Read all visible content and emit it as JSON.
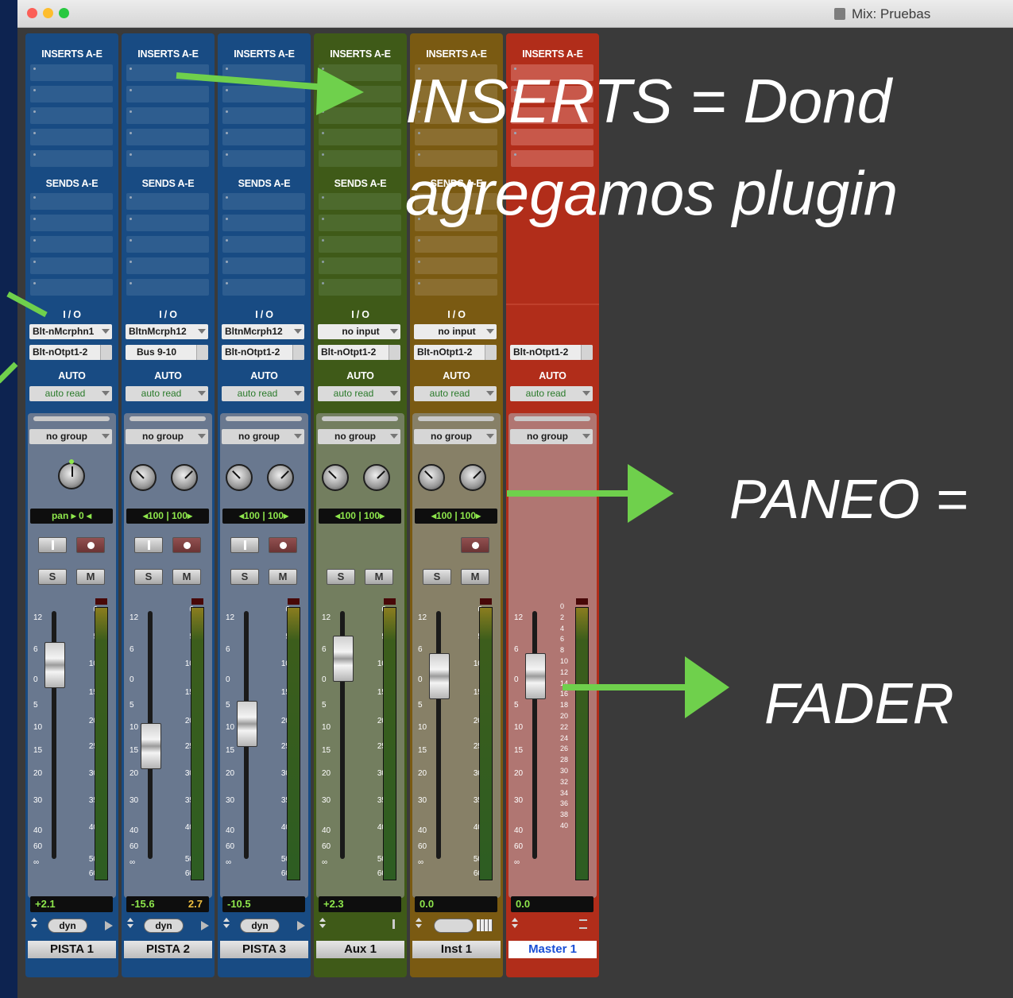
{
  "window": {
    "title": "Mix: Pruebas"
  },
  "tracks": [
    {
      "name": "PISTA 1",
      "color": "#184b83",
      "panel": "#69788f",
      "inserts_label": "INSERTS A-E",
      "sends_label": "SENDS A-E",
      "io_label": "I / O",
      "input": "Blt-nMcrphn1",
      "output": "Blt-nOtpt1-2",
      "auto_label": "AUTO",
      "auto_mode": "auto read",
      "group": "no group",
      "pan_text": "pan   ▸ 0 ◂",
      "volume": "+2.1",
      "peak": "",
      "mode_label": "dyn",
      "selected": false
    },
    {
      "name": "PISTA 2",
      "color": "#184b83",
      "panel": "#69788f",
      "inserts_label": "INSERTS A-E",
      "sends_label": "SENDS A-E",
      "io_label": "I / O",
      "input": "BltnMcrph12",
      "output": "Bus 9-10",
      "auto_label": "AUTO",
      "auto_mode": "auto read",
      "group": "no group",
      "pan_text": "◂100 | 100▸",
      "volume": "-15.6",
      "peak": "2.7",
      "mode_label": "dyn",
      "selected": false
    },
    {
      "name": "PISTA 3",
      "color": "#184b83",
      "panel": "#69788f",
      "inserts_label": "INSERTS A-E",
      "sends_label": "SENDS A-E",
      "io_label": "I / O",
      "input": "BltnMcrph12",
      "output": "Blt-nOtpt1-2",
      "auto_label": "AUTO",
      "auto_mode": "auto read",
      "group": "no group",
      "pan_text": "◂100 | 100▸",
      "volume": "-10.5",
      "peak": "",
      "mode_label": "dyn",
      "selected": false
    },
    {
      "name": "Aux 1",
      "color": "#3f5a18",
      "panel": "#737e5f",
      "inserts_label": "INSERTS A-E",
      "sends_label": "SENDS A-E",
      "io_label": "I / O",
      "input": "no input",
      "output": "Blt-nOtpt1-2",
      "auto_label": "AUTO",
      "auto_mode": "auto read",
      "group": "no group",
      "pan_text": "◂100 | 100▸",
      "volume": "+2.3",
      "peak": "",
      "mode_label": "",
      "selected": false
    },
    {
      "name": "Inst 1",
      "color": "#7a5a12",
      "panel": "#878067",
      "inserts_label": "INSERTS A-E",
      "sends_label": "SENDS A-E",
      "io_label": "I / O",
      "input": "no input",
      "output": "Blt-nOtpt1-2",
      "auto_label": "AUTO",
      "auto_mode": "auto read",
      "group": "no group",
      "pan_text": "◂100 | 100▸",
      "volume": "0.0",
      "peak": "",
      "mode_label": "",
      "selected": false
    },
    {
      "name": "Master 1",
      "color": "#b12d1a",
      "panel": "#b07672",
      "inserts_label": "INSERTS A-E",
      "sends_label": "",
      "io_label": "",
      "input": "",
      "output": "Blt-nOtpt1-2",
      "auto_label": "AUTO",
      "auto_mode": "auto read",
      "group": "no group",
      "pan_text": "",
      "volume": "0.0",
      "peak": "",
      "mode_label": "",
      "selected": true
    }
  ],
  "buttons": {
    "input": "I",
    "solo": "S",
    "mute": "M"
  },
  "fader_scale": [
    "12",
    "6",
    "0",
    "5",
    "10",
    "15",
    "20",
    "30",
    "40",
    "60",
    "∞"
  ],
  "meter_scale": [
    "0",
    "5",
    "10",
    "15",
    "20",
    "25",
    "30",
    "35",
    "40",
    "50",
    "60"
  ],
  "master_meter_scale": [
    "0",
    "2",
    "4",
    "6",
    "8",
    "10",
    "12",
    "14",
    "16",
    "18",
    "20",
    "22",
    "24",
    "26",
    "28",
    "30",
    "32",
    "34",
    "36",
    "38",
    "40"
  ],
  "annotations": {
    "inserts_line1": "INSERTS = Dond",
    "inserts_line2": "agregamos plugin",
    "paneo": "PANEO =",
    "fader": "FADER"
  },
  "colors": {
    "arrow": "#6fd04c",
    "background": "#0d2350",
    "window": "#3a3a3a"
  }
}
